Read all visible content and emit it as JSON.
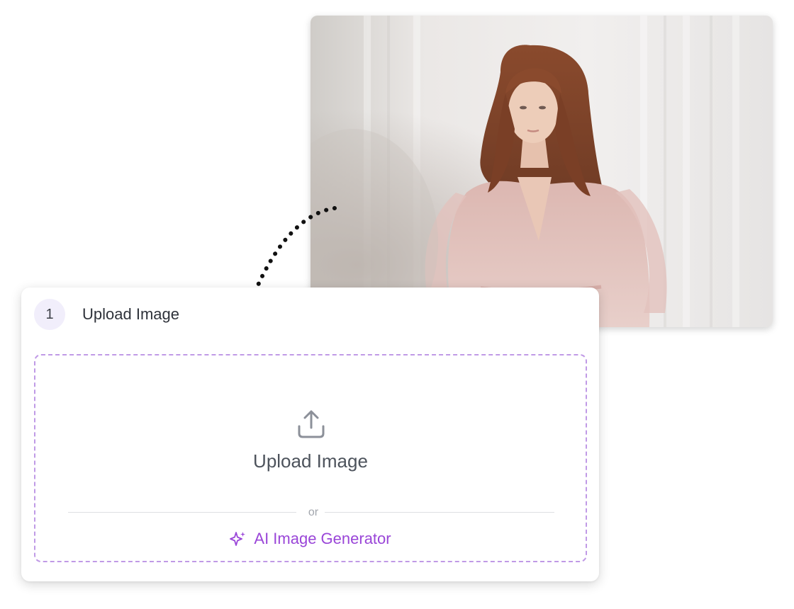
{
  "upload_card": {
    "step_number": "1",
    "step_title": "Upload Image",
    "dropzone": {
      "icon": "upload-icon",
      "label": "Upload Image",
      "divider_text": "or",
      "ai_link": {
        "icon": "sparkle-icon",
        "label": "AI Image Generator"
      }
    }
  },
  "colors": {
    "accent_purple": "#9a46d8",
    "dashed_border": "#c09ae6",
    "step_circle_bg": "#f1eefb"
  }
}
